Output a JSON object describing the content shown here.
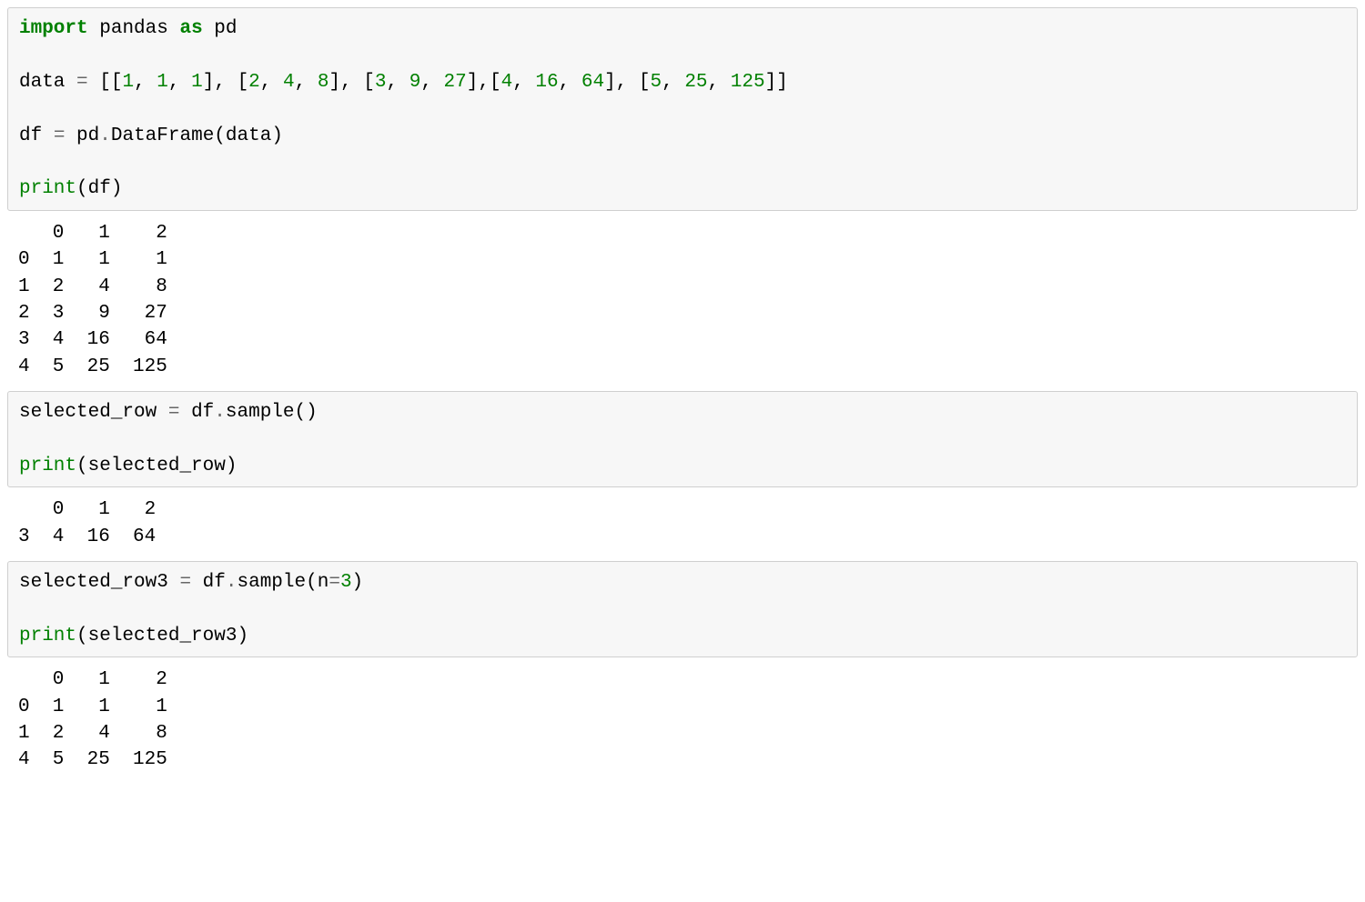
{
  "cell1": {
    "kw_import": "import",
    "pandas": "pandas",
    "kw_as": "as",
    "pd": "pd",
    "data_name": "data",
    "eq": "=",
    "lb": "[",
    "rb": "]",
    "lp": "(",
    "rp": ")",
    "comma": ",",
    "n1": "1",
    "n2": "2",
    "n3": "3",
    "n4": "4",
    "n5": "5",
    "n8": "8",
    "n9": "9",
    "n16": "16",
    "n25": "25",
    "n27": "27",
    "n64": "64",
    "n125": "125",
    "df": "df",
    "dot": ".",
    "DataFrame": "DataFrame",
    "data_ref": "data",
    "print": "print",
    "df_ref": "df"
  },
  "out1": "   0   1    2\n0  1   1    1\n1  2   4    8\n2  3   9   27\n3  4  16   64\n4  5  25  125",
  "cell2": {
    "selected_row": "selected_row",
    "eq": "=",
    "df": "df",
    "dot": ".",
    "sample": "sample",
    "lp": "(",
    "rp": ")",
    "print": "print",
    "selected_row_ref": "selected_row"
  },
  "out2": "   0   1   2\n3  4  16  64",
  "cell3": {
    "selected_row3": "selected_row3",
    "eq": "=",
    "df": "df",
    "dot": ".",
    "sample": "sample",
    "lp": "(",
    "n_kw": "n",
    "eq2": "=",
    "three": "3",
    "rp": ")",
    "print": "print",
    "selected_row3_ref": "selected_row3"
  },
  "out3": "   0   1    2\n0  1   1    1\n1  2   4    8\n4  5  25  125"
}
